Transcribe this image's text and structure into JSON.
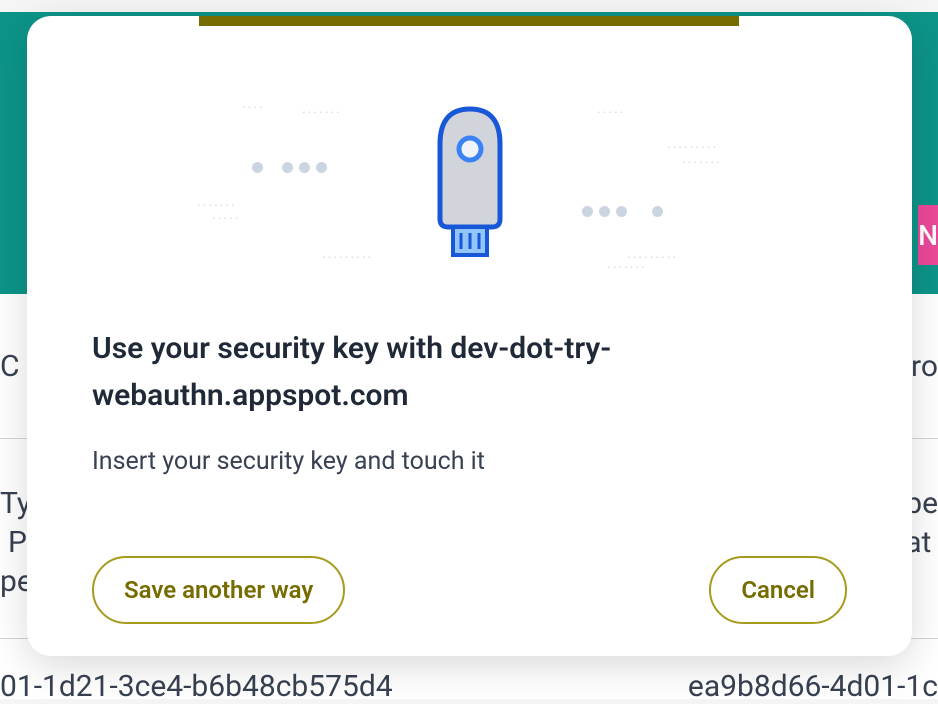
{
  "background": {
    "badge_letter": "N",
    "row1_left": "C",
    "row1_right": "ro",
    "row2_left_line1": "Ty",
    "row2_left_line2": "P",
    "row2_left_line3": "pe",
    "row2_right_line1": "pe",
    "row2_right_line2": "at",
    "row3_left": "01-1d21-3ce4-b6b48cb575d4",
    "row3_right": "ea9b8d66-4d01-1c"
  },
  "dialog": {
    "title": "Use your security key with dev-dot-try-webauthn.appspot.com",
    "instruction": "Insert your security key and touch it",
    "save_another_way_label": "Save another way",
    "cancel_label": "Cancel"
  },
  "colors": {
    "accent": "#766c00",
    "teal": "#0d9488",
    "pink": "#ec4899",
    "key_blue": "#1757d8"
  }
}
